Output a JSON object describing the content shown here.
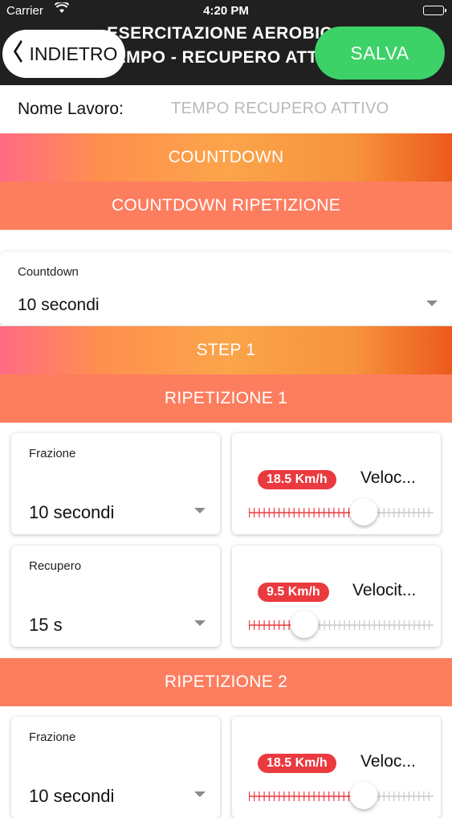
{
  "status_bar": {
    "carrier": "Carrier",
    "time": "4:20 PM"
  },
  "nav": {
    "title_line1": "ESERCITAZIONE AEROBICA",
    "title_line2": "TEMPO - RECUPERO ATTIVO",
    "back_label": "INDIETRO",
    "save_label": "SALVA"
  },
  "name_row": {
    "label": "Nome Lavoro:",
    "value": "TEMPO RECUPERO ATTIVO"
  },
  "bands": {
    "countdown": "COUNTDOWN",
    "countdown_repetition": "COUNTDOWN RIPETIZIONE",
    "step1": "STEP 1",
    "rep1": "RIPETIZIONE 1",
    "rep2": "RIPETIZIONE 2"
  },
  "countdown": {
    "caption": "Countdown",
    "value": "10 secondi"
  },
  "repetitions": [
    {
      "fraction": {
        "caption": "Frazione",
        "value": "10 secondi"
      },
      "fraction_speed": {
        "badge": "18.5 Km/h",
        "label": "Veloc...",
        "level": 0.62
      },
      "recovery": {
        "caption": "Recupero",
        "value": "15 s"
      },
      "recovery_speed": {
        "badge": "9.5 Km/h",
        "label": "Velocit...",
        "level": 0.3
      }
    },
    {
      "fraction": {
        "caption": "Frazione",
        "value": "10 secondi"
      },
      "fraction_speed": {
        "badge": "18.5 Km/h",
        "label": "Veloc...",
        "level": 0.62
      }
    }
  ],
  "colors": {
    "nav_bg": "#202020",
    "save_green": "#3dd267",
    "band_coral": "#fd7d5f",
    "badge_red": "#ea3a3f",
    "placeholder_gray": "#b9b9b9"
  },
  "icons": {
    "back": "chevron-left-icon",
    "wifi": "wifi-icon",
    "battery": "battery-icon",
    "dropdown": "chevron-down-icon"
  }
}
